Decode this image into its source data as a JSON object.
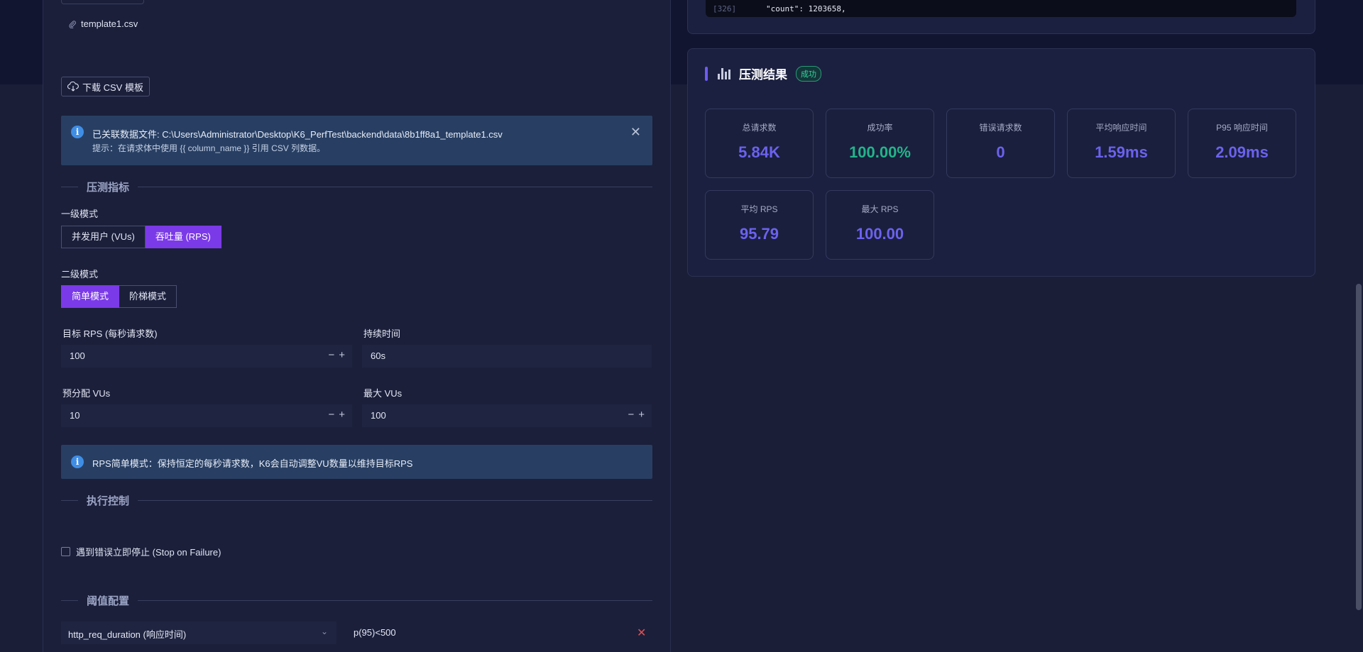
{
  "file": {
    "name": "template1.csv",
    "icon": "paperclip-icon"
  },
  "download_button": {
    "label": "下载 CSV 模板",
    "icon": "cloud-download-icon"
  },
  "csv_alert": {
    "line1": "已关联数据文件: C:\\Users\\Administrator\\Desktop\\K6_PerfTest\\backend\\data\\8b1ff8a1_template1.csv",
    "line2": "提示：在请求体中使用 {{ column_name }} 引用 CSV 列数据。"
  },
  "sections": {
    "metrics": "压测指标",
    "execution": "执行控制",
    "threshold": "阈值配置"
  },
  "primary_mode": {
    "label": "一级模式",
    "options": [
      "并发用户 (VUs)",
      "吞吐量 (RPS)"
    ],
    "selected": "吞吐量 (RPS)"
  },
  "secondary_mode": {
    "label": "二级模式",
    "options": [
      "简单模式",
      "阶梯模式"
    ],
    "selected": "简单模式"
  },
  "fields": {
    "target_rps": {
      "label": "目标 RPS (每秒请求数)",
      "value": "100"
    },
    "duration": {
      "label": "持续时间",
      "value": "60s"
    },
    "prealloc_vus": {
      "label": "预分配 VUs",
      "value": "10"
    },
    "max_vus": {
      "label": "最大 VUs",
      "value": "100"
    }
  },
  "rps_alert": {
    "text": "RPS简单模式：保持恒定的每秒请求数，K6会自动调整VU数量以维持目标RPS"
  },
  "stop_on_failure": {
    "label": "遇到错误立即停止 (Stop on Failure)",
    "checked": false
  },
  "threshold": {
    "metric": "http_req_duration (响应时间)",
    "condition": "p(95)<500"
  },
  "code": {
    "line_no": "[326]",
    "text": "\"count\": 1203658,"
  },
  "result": {
    "title": "压测结果",
    "status": "成功",
    "stats": [
      {
        "label": "总请求数",
        "value": "5.84K"
      },
      {
        "label": "成功率",
        "value": "100.00%"
      },
      {
        "label": "错误请求数",
        "value": "0"
      },
      {
        "label": "平均响应时间",
        "value": "1.59ms"
      },
      {
        "label": "P95 响应时间",
        "value": "2.09ms"
      },
      {
        "label": "平均 RPS",
        "value": "95.79"
      },
      {
        "label": "最大 RPS",
        "value": "100.00"
      }
    ]
  },
  "colors": {
    "accent": "#7b3ae8",
    "stat_value": "#6b62ee",
    "success": "#22b58a",
    "danger": "#e15050"
  }
}
